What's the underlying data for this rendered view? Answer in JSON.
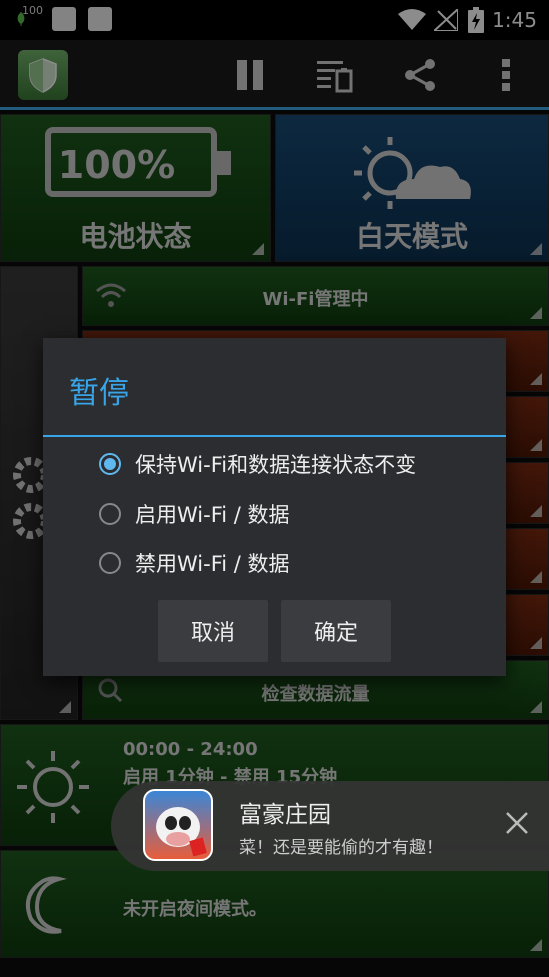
{
  "status_bar": {
    "battery_level": "100",
    "time": "1:45"
  },
  "tiles": {
    "battery": {
      "percent": "100%",
      "label": "电池状态"
    },
    "day_mode": {
      "label": "白天模式"
    },
    "wifi": {
      "label": "Wi-Fi管理中"
    },
    "data_usage": {
      "label": "检查数据流量"
    },
    "schedule": {
      "time_range": "00:00 - 24:00",
      "detail": "启用 1分钟 - 禁用 15分钟"
    },
    "night": {
      "label": "未开启夜间模式。"
    }
  },
  "dialog": {
    "title": "暂停",
    "options": [
      {
        "label": "保持Wi-Fi和数据连接状态不变",
        "selected": true
      },
      {
        "label": "启用Wi-Fi / 数据",
        "selected": false
      },
      {
        "label": "禁用Wi-Fi / 数据",
        "selected": false
      }
    ],
    "cancel_label": "取消",
    "ok_label": "确定"
  },
  "toast": {
    "title": "富豪庄园",
    "subtitle": "菜！还是要能偷的才有趣！"
  },
  "colors": {
    "accent": "#38a5e8",
    "tile_green": "#1f5a1f",
    "tile_blue": "#184a75",
    "tile_brown": "#7a2a12"
  }
}
